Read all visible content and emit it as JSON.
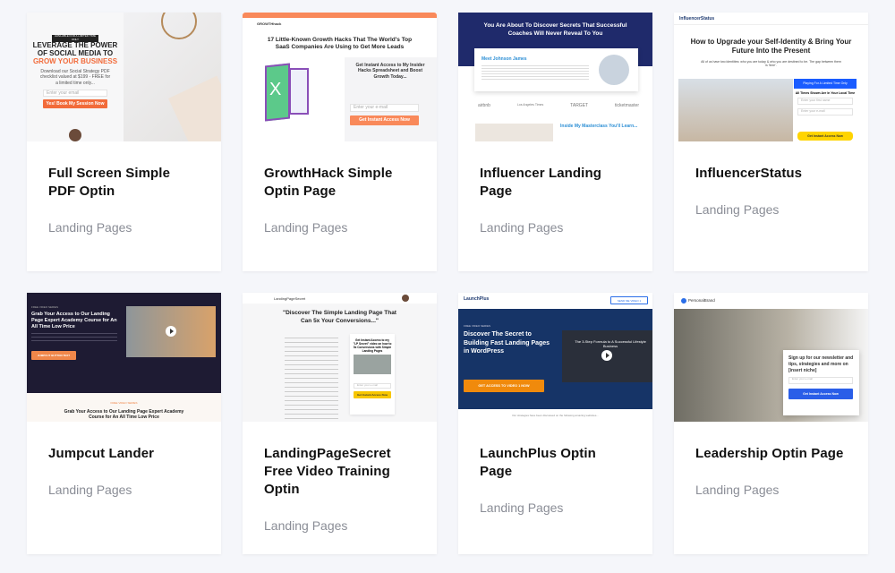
{
  "cards": [
    {
      "title": "Full Screen Simple PDF Optin",
      "category": "Landing Pages",
      "thumb": {
        "badge": "AVAILABLE FOR A LIMITED TIME ONLY",
        "h1a": "LEVERAGE THE POWER OF SOCIAL MEDIA TO ",
        "h1b": "GROW YOUR BUSINESS",
        "text": "Download our Social Strategy PDF checklist valued at $199 - FREE for a limited time only...",
        "input": "Enter your email",
        "button": "Yes! Book My Session Now",
        "accent": "#f26b3a"
      }
    },
    {
      "title": "GrowthHack Simple Optin Page",
      "category": "Landing Pages",
      "thumb": {
        "logo": "GROWTHhack",
        "h1": "17 Little-Known Growth Hacks That The World's Top SaaS Companies Are Using to Get More Leads",
        "h2": "Get Instant Access to My Insider Hacks Spreadsheet and Boost Growth Today...",
        "input": "Enter your e-mail",
        "button": "Get Instant Access Now",
        "accent": "#f9895a"
      }
    },
    {
      "title": "Influencer Landing Page",
      "category": "Landing Pages",
      "thumb": {
        "h1": "You Are About To Discover Secrets That Successful Coaches Will Never Reveal To You",
        "name": "Meet Johnson James",
        "brands": [
          "airbnb",
          "Los Angeles Times",
          "TARGET",
          "ticketmaster"
        ],
        "h2": "Inside My Masterclass You'll Learn...",
        "accent": "#1f2a6b"
      }
    },
    {
      "title": "InfluencerStatus",
      "category": "Landing Pages",
      "thumb": {
        "logo": "InfluencerStatus",
        "h1": "How to Upgrade your Self-Identity & Bring Your Future Into the Present",
        "sub": "All of us have two identities: who you are today & who you are destined to be. The gap between them is 'time'.",
        "banner": "Playing For A Limited Time Only",
        "times": "All Times Shown Are In Your Local Time",
        "input1": "Enter your first name",
        "input2": "Enter your e-mail",
        "button": "Get Instant Access Now",
        "accent": "#1a5cff"
      }
    },
    {
      "title": "Jumpcut Lander",
      "category": "Landing Pages",
      "thumb": {
        "label": "FREE VIDEO SERIES",
        "h1": "Grab Your Access to Our Landing Page Expert Academy Course for An All Time Low Price",
        "button": "JUMPCUT BUTTON TEXT",
        "label2": "FREE VIDEO SERIES",
        "h2": "Grab Your Access to Our Landing Page Expert Academy Course for An All Time Low Price",
        "accent": "#1e1b33"
      }
    },
    {
      "title": "LandingPageSecret Free Video Training Optin",
      "category": "Landing Pages",
      "thumb": {
        "logo": "LandingPageSecret",
        "h1": "\"Discover The Simple Landing Page That Can 5x Your Conversions...\"",
        "side": "Get Instant Access to my \"LP Secret\" video on how to 5x Conversions with Simple Landing Pages",
        "input": "Enter your e-mail",
        "button": "Get Instant Access Now",
        "accent": "#f7c600"
      }
    },
    {
      "title": "LaunchPlus Optin Page",
      "category": "Landing Pages",
      "thumb": {
        "logo": "LaunchPlus",
        "nav": "SEND ME VIDEO 1",
        "label": "FREE VIDEO SERIES",
        "h1": "Discover The Secret to Building Fast Landing Pages in WordPress",
        "button": "GET ACCESS TO VIDEO 1 NOW",
        "video": "The 3-Step Formula to A Successful Lifestyle Business",
        "foot": "Our strategies have been discussed on the following amazing websites...",
        "accent": "#f08a0c"
      }
    },
    {
      "title": "Leadership Optin Page",
      "category": "Landing Pages",
      "thumb": {
        "logo": "PersonalBrand",
        "h1": "Sign up for our newsletter and tips, strategies and more on [insert niche]",
        "input": "Enter your e-mail",
        "button": "Get Instant Access Now",
        "accent": "#2a5ee8"
      }
    }
  ]
}
